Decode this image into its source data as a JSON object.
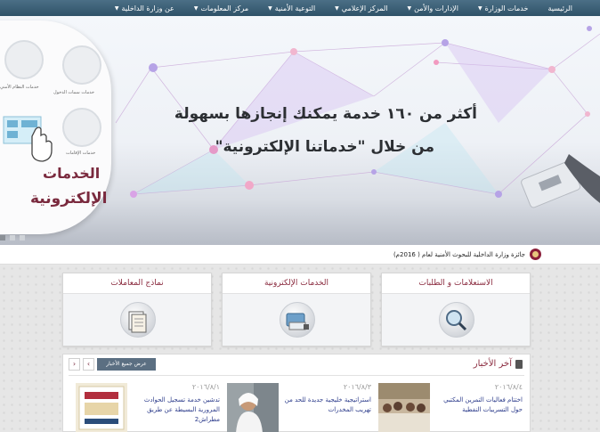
{
  "nav": {
    "items": [
      {
        "label": "الرئيسية",
        "caret": false
      },
      {
        "label": "خدمات الوزارة",
        "caret": true
      },
      {
        "label": "الإدارات والأمن",
        "caret": true
      },
      {
        "label": "المركز الإعلامي",
        "caret": true
      },
      {
        "label": "التوعية الأمنية",
        "caret": true
      },
      {
        "label": "مركز المعلومات",
        "caret": true
      },
      {
        "label": "عن وزارة الداخلية",
        "caret": true
      }
    ]
  },
  "hero": {
    "headline_line1": "أكثر من ١٦٠ خدمة يمكنك إنجازها بسهولة",
    "headline_line2": "من خلال \"خدماتنا الإلكترونية\"",
    "panel_title_1": "الخدمات",
    "panel_title_2": "الإلكترونية",
    "tile_captions": [
      "خدمات النظام الأمني",
      "خدمات الدخول",
      "خدمات سمات الدخول",
      "خدمات الإقامات"
    ]
  },
  "ticker": {
    "text": "جائزة وزارة الداخلية للبحوث الأمنية لعام ( 2016م)"
  },
  "cards": [
    {
      "label": "الاستعلامات و الطلبات",
      "icon": "magnifier-icon"
    },
    {
      "label": "الخدمات الإلكترونية",
      "icon": "card-terminal-icon"
    },
    {
      "label": "نماذج المعاملات",
      "icon": "forms-icon"
    }
  ],
  "news": {
    "title": "آخر الأخبار",
    "all_button": "عرض جميع الأخبار",
    "items": [
      {
        "date": "٢٠١٦/٨/٤",
        "text": "اختتام فعاليات التمرين المكتبي حول التسريبات النفطية"
      },
      {
        "date": "٢٠١٦/٨/٣",
        "text": "استراتيجية خليجية جديدة للحد من تهريب المخدرات"
      },
      {
        "date": "٢٠١٦/٨/١",
        "text": "تدشين خدمة تسجيل الحوادث المرورية البسيطة عن طريق مطراش2"
      }
    ]
  },
  "colors": {
    "nav_bg": "#3b5f76",
    "accent_maroon": "#8a2a3e",
    "news_link": "#2a3a8a",
    "button_bg": "#5b6f82"
  }
}
